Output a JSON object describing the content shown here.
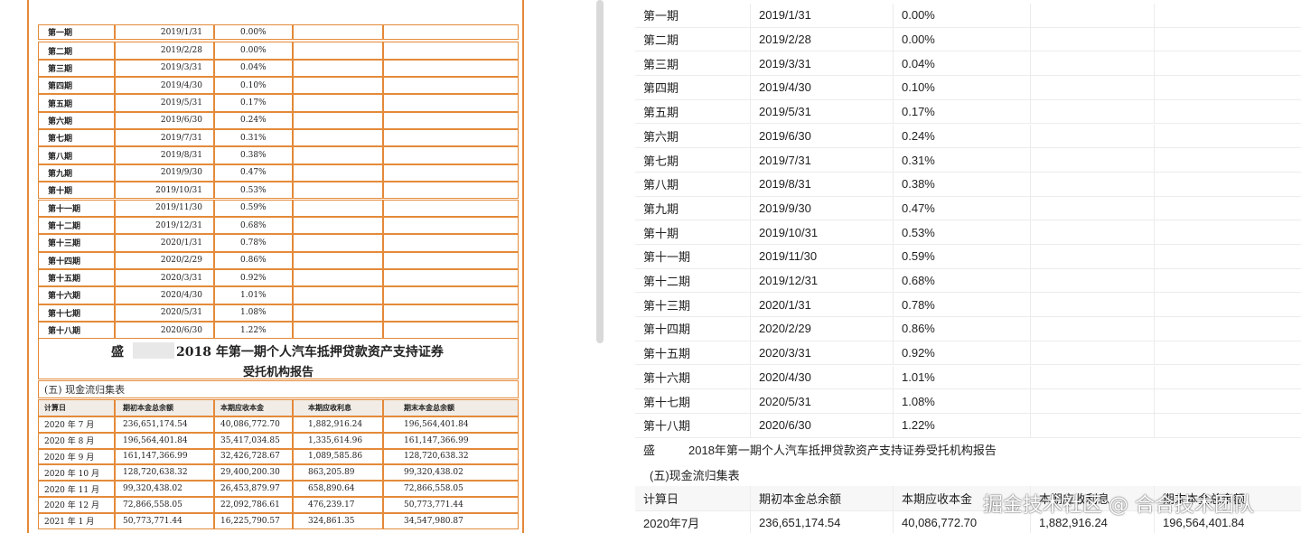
{
  "periods": [
    {
      "name": "第一期",
      "date": "2019/1/31",
      "rate": "0.00%"
    },
    {
      "name": "第二期",
      "date": "2019/2/28",
      "rate": "0.00%"
    },
    {
      "name": "第三期",
      "date": "2019/3/31",
      "rate": "0.04%"
    },
    {
      "name": "第四期",
      "date": "2019/4/30",
      "rate": "0.10%"
    },
    {
      "name": "第五期",
      "date": "2019/5/31",
      "rate": "0.17%"
    },
    {
      "name": "第六期",
      "date": "2019/6/30",
      "rate": "0.24%"
    },
    {
      "name": "第七期",
      "date": "2019/7/31",
      "rate": "0.31%"
    },
    {
      "name": "第八期",
      "date": "2019/8/31",
      "rate": "0.38%"
    },
    {
      "name": "第九期",
      "date": "2019/9/30",
      "rate": "0.47%"
    },
    {
      "name": "第十期",
      "date": "2019/10/31",
      "rate": "0.53%"
    },
    {
      "name": "第十一期",
      "date": "2019/11/30",
      "rate": "0.59%"
    },
    {
      "name": "第十二期",
      "date": "2019/12/31",
      "rate": "0.68%"
    },
    {
      "name": "第十三期",
      "date": "2020/1/31",
      "rate": "0.78%"
    },
    {
      "name": "第十四期",
      "date": "2020/2/29",
      "rate": "0.86%"
    },
    {
      "name": "第十五期",
      "date": "2020/3/31",
      "rate": "0.92%"
    },
    {
      "name": "第十六期",
      "date": "2020/4/30",
      "rate": "1.01%"
    },
    {
      "name": "第十七期",
      "date": "2020/5/31",
      "rate": "1.08%"
    },
    {
      "name": "第十八期",
      "date": "2020/6/30",
      "rate": "1.22%"
    }
  ],
  "scan": {
    "title_prefix": "盛",
    "title_rest": "2018 年第一期个人汽车抵押贷款资产支持证券",
    "title_line2": "受托机构报告",
    "section": "(五) 现金流归集表",
    "flow_headers": [
      "计算日",
      "期初本金总余额",
      "本期应收本金",
      "本期应收利息",
      "期末本金总余额"
    ],
    "flow_rows": [
      [
        "2020 年 7 月",
        "236,651,174.54",
        "40,086,772.70",
        "1,882,916.24",
        "196,564,401.84"
      ],
      [
        "2020 年 8 月",
        "196,564,401.84",
        "35,417,034.85",
        "1,335,614.96",
        "161,147,366.99"
      ],
      [
        "2020 年 9 月",
        "161,147,366.99",
        "32,426,728.67",
        "1,089,585.86",
        "128,720,638.32"
      ],
      [
        "2020 年 10 月",
        "128,720,638.32",
        "29,400,200.30",
        "863,205.89",
        "99,320,438.02"
      ],
      [
        "2020 年 11 月",
        "99,320,438.02",
        "26,453,879.97",
        "658,890.64",
        "72,866,558.05"
      ],
      [
        "2020 年 12 月",
        "72,866,558.05",
        "22,092,786.61",
        "476,239.17",
        "50,773,771.44"
      ],
      [
        "2021 年 1 月",
        "50,773,771.44",
        "16,225,790.57",
        "324,861.35",
        "34,547,980.87"
      ]
    ]
  },
  "parsed": {
    "title_prefix": "盛",
    "title_rest": "2018年第一期个人汽车抵押贷款资产支持证券受托机构报告",
    "section": "(五)现金流归集表",
    "flow_headers": [
      "计算日",
      "期初本金总余额",
      "本期应收本金",
      "本期应收利息",
      "期末本金总余额"
    ],
    "flow_row": [
      "2020年7月",
      "236,651,174.54",
      "40,086,772.70",
      "1,882,916.24",
      "196,564,401.84"
    ]
  },
  "watermark": "掘金技术社区 @ 合合技术团队",
  "colors": {
    "scan_border": "#e48a3a",
    "grid": "#ececec",
    "divider": "#d9d9d9"
  }
}
